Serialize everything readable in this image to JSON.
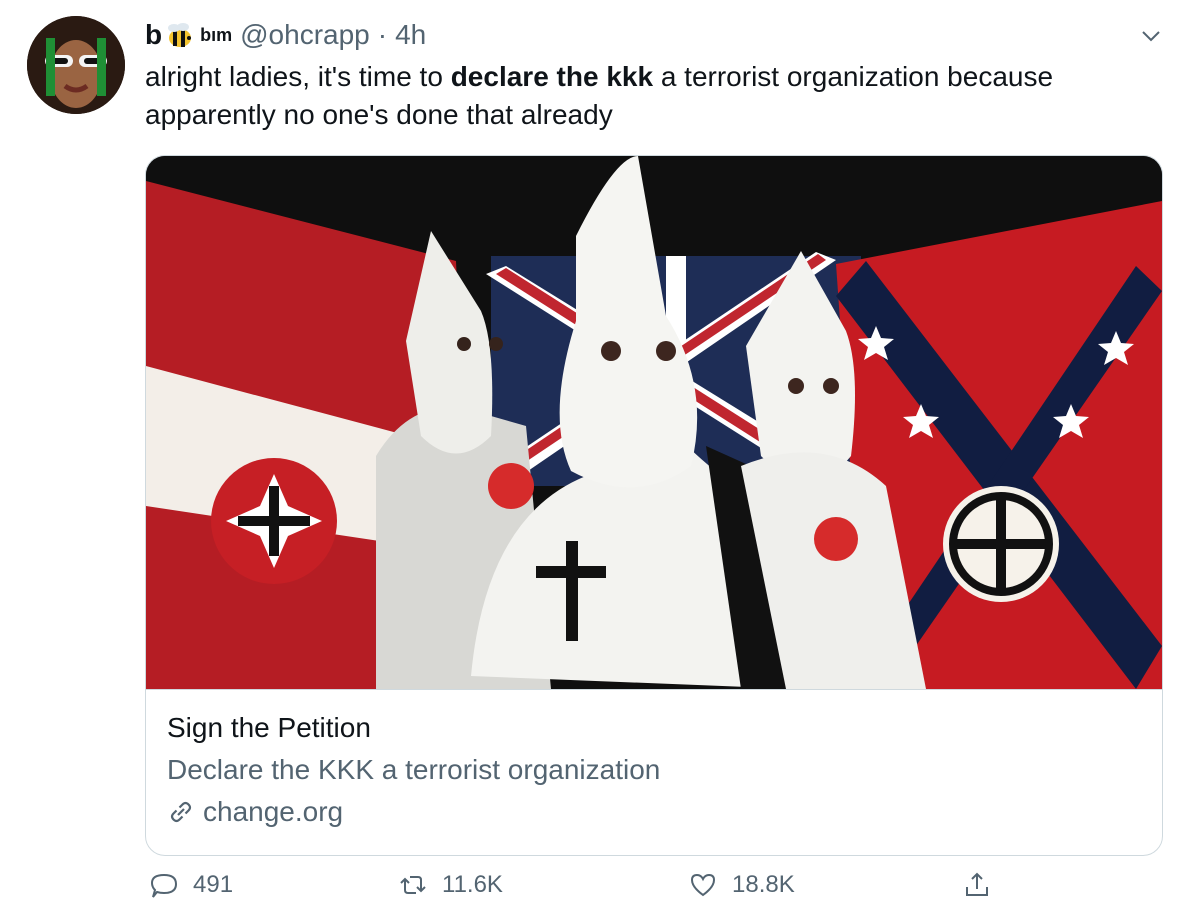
{
  "tweet": {
    "display_name_prefix": "b",
    "display_name_suffix": "bım",
    "handle": "@ohcrapp",
    "separator": "·",
    "time": "4h",
    "text_before_bold": "alright ladies, it's time to ",
    "text_bold": "declare the kkk",
    "text_after_bold": " a terrorist organization because apparently no one's done that already"
  },
  "card": {
    "title": "Sign the Petition",
    "description": "Declare the KKK a terrorist organization",
    "domain": "change.org"
  },
  "actions": {
    "replies": "491",
    "retweets": "11.6K",
    "likes": "18.8K"
  },
  "colors": {
    "text_primary": "#0f1419",
    "text_secondary": "#536471",
    "border": "#cfd9de"
  },
  "icons": [
    "bee-emoji-icon",
    "chevron-down-icon",
    "link-icon",
    "reply-icon",
    "retweet-icon",
    "like-icon",
    "share-icon"
  ]
}
